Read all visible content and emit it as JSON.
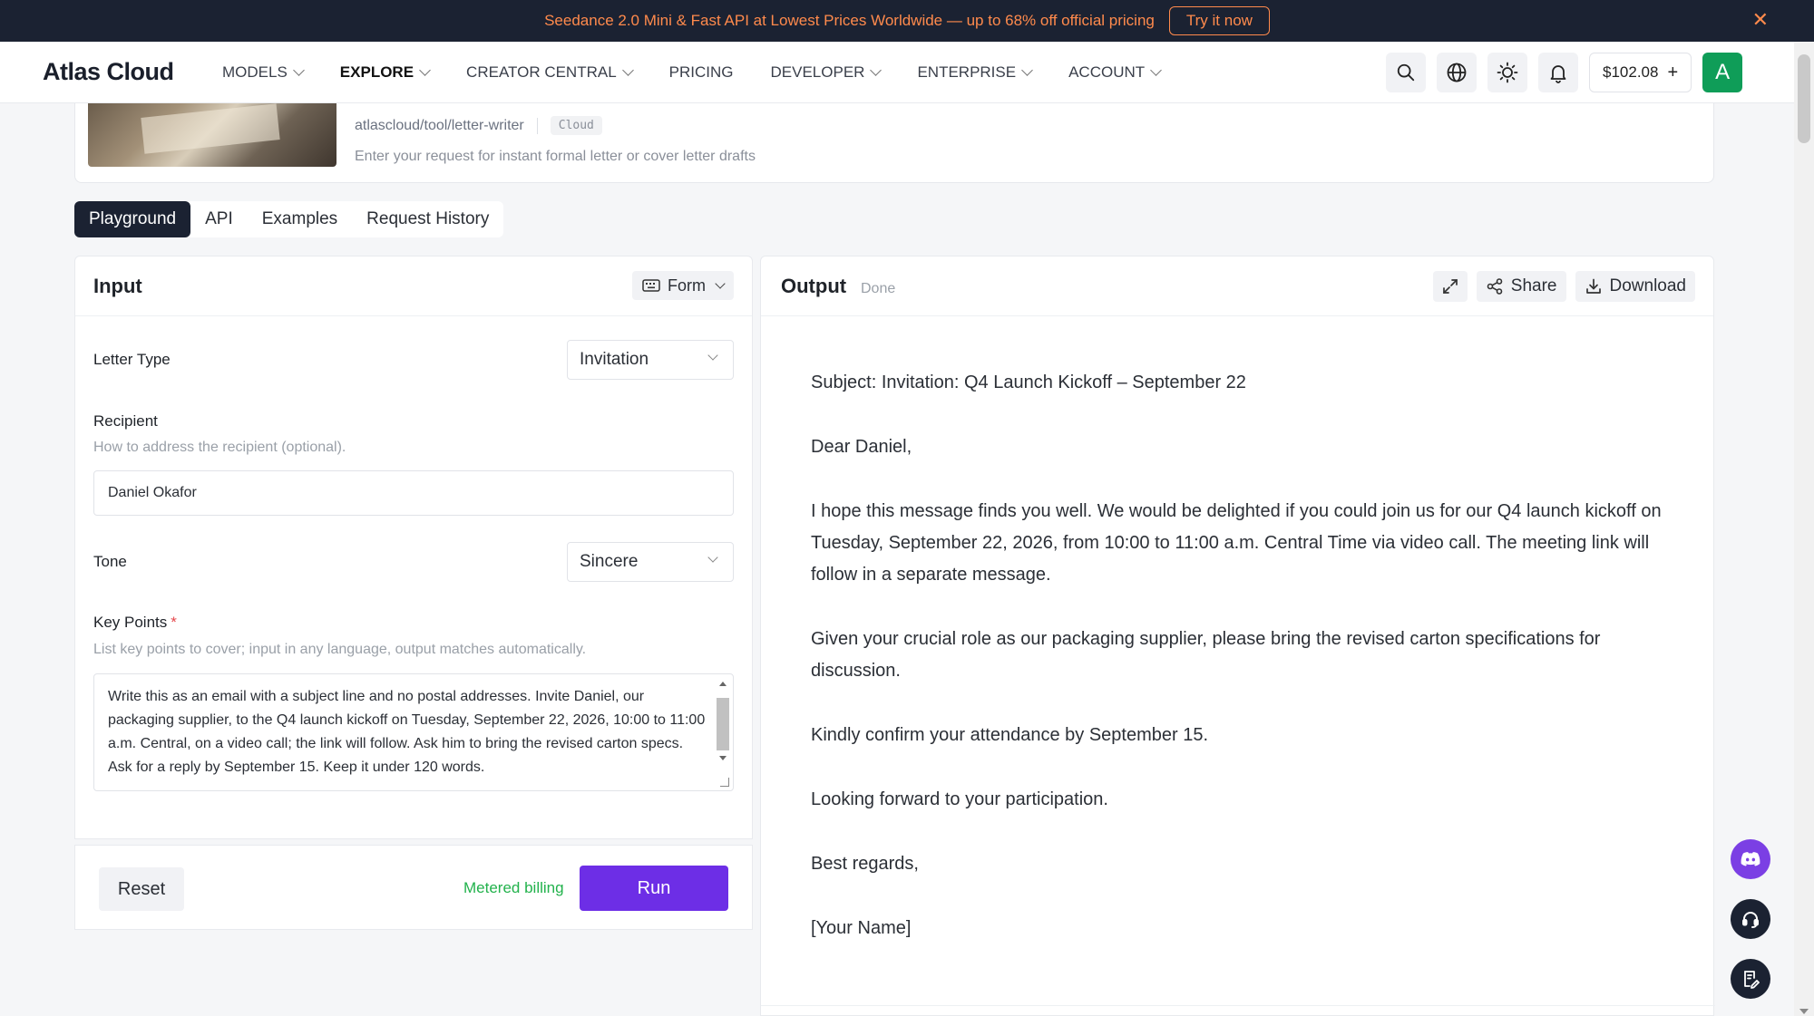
{
  "banner": {
    "text": "Seedance 2.0 Mini & Fast API at Lowest Prices Worldwide — up to 68% off official pricing",
    "cta": "Try it now",
    "close": "✕"
  },
  "nav": {
    "logo": "Atlas Cloud",
    "items": [
      {
        "label": "MODELS"
      },
      {
        "label": "EXPLORE"
      },
      {
        "label": "CREATOR CENTRAL"
      },
      {
        "label": "PRICING"
      },
      {
        "label": "DEVELOPER"
      },
      {
        "label": "ENTERPRISE"
      },
      {
        "label": "ACCOUNT"
      }
    ],
    "balance": "$102.08",
    "balance_add": "+",
    "avatar": "A"
  },
  "tool": {
    "path": "atlascloud/tool/letter-writer",
    "tag": "Cloud",
    "description": "Enter your request for instant formal letter or cover letter drafts"
  },
  "tabs": [
    {
      "label": "Playground"
    },
    {
      "label": "API"
    },
    {
      "label": "Examples"
    },
    {
      "label": "Request History"
    }
  ],
  "input": {
    "title": "Input",
    "mode": "Form",
    "letter_type": {
      "label": "Letter Type",
      "value": "Invitation"
    },
    "recipient": {
      "label": "Recipient",
      "help": "How to address the recipient (optional).",
      "value": "Daniel Okafor"
    },
    "tone": {
      "label": "Tone",
      "value": "Sincere"
    },
    "key_points": {
      "label": "Key Points",
      "required_mark": "*",
      "help": "List key points to cover; input in any language, output matches automatically.",
      "value": "Write this as an email with a subject line and no postal addresses. Invite Daniel, our packaging supplier, to the Q4 launch kickoff on Tuesday, September 22, 2026, 10:00 to 11:00 a.m. Central, on a video call; the link will follow. Ask him to bring the revised carton specs. Ask for a reply by September 15. Keep it under 120 words."
    },
    "reset": "Reset",
    "billing": "Metered billing",
    "run": "Run"
  },
  "output": {
    "title": "Output",
    "status": "Done",
    "share": "Share",
    "download": "Download",
    "paragraphs": [
      "Subject: Invitation: Q4 Launch Kickoff – September 22",
      "Dear Daniel,",
      "I hope this message finds you well. We would be delighted if you could join us for our Q4 launch kickoff on Tuesday, September 22, 2026, from 10:00 to 11:00 a.m. Central Time via video call. The meeting link will follow in a separate message.",
      "Given your crucial role as our packaging supplier, please bring the revised carton specifications for discussion.",
      "Kindly confirm your attendance by September 15.",
      "Looking forward to your participation.",
      "Best regards,",
      "[Your Name]"
    ]
  },
  "colors": {
    "banner_bg": "#1b2232",
    "banner_text": "#ff8a4c",
    "run_button": "#6d2ee6",
    "metered": "#22b24c",
    "avatar_bg": "#0f9d58"
  }
}
